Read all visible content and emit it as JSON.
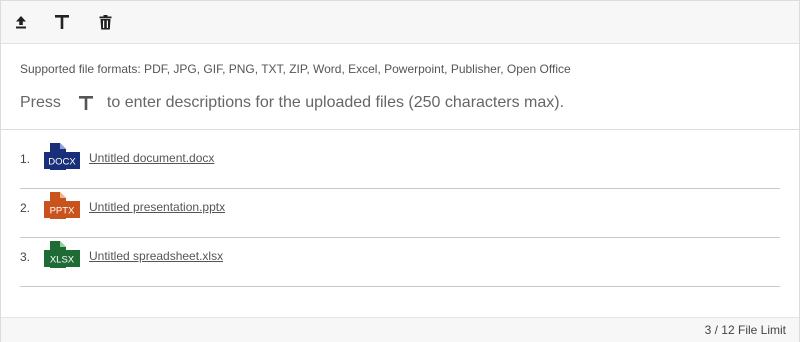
{
  "toolbar": {
    "icons": [
      "upload-icon",
      "text-icon",
      "trash-icon"
    ]
  },
  "info": {
    "formats": "Supported file formats: PDF, JPG, GIF, PNG, TXT, ZIP, Word, Excel, Powerpoint, Publisher, Open Office",
    "press_before": "Press",
    "press_after": "to enter descriptions for the uploaded files (250 characters max)."
  },
  "files": [
    {
      "number": "1.",
      "icon_label": "DOCX",
      "icon_color": "#1a2f7a",
      "name": "Untitled document.docx"
    },
    {
      "number": "2.",
      "icon_label": "PPTX",
      "icon_color": "#c9531c",
      "name": "Untitled presentation.pptx"
    },
    {
      "number": "3.",
      "icon_label": "XLSX",
      "icon_color": "#1f6b36",
      "name": "Untitled spreadsheet.xlsx"
    }
  ],
  "footer": {
    "limit_text": "3 / 12 File Limit"
  }
}
